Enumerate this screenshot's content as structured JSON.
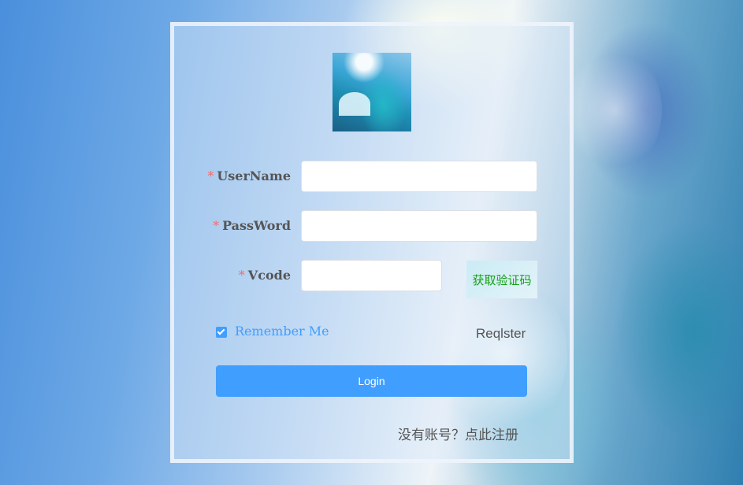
{
  "form": {
    "username_label": "UserName",
    "password_label": "PassWord",
    "vcode_label": "Vcode",
    "required_mark": "*",
    "username_value": "",
    "password_value": "",
    "vcode_value": "",
    "get_code_button": "获取验证码",
    "remember_label": "Remember Me",
    "remember_checked": true,
    "register_link": "Reqlster",
    "login_button": "Login",
    "signup_prompt": "没有账号？点此注册"
  },
  "colors": {
    "primary": "#409eff",
    "required": "#f56c6c",
    "code_text": "#18a018"
  }
}
